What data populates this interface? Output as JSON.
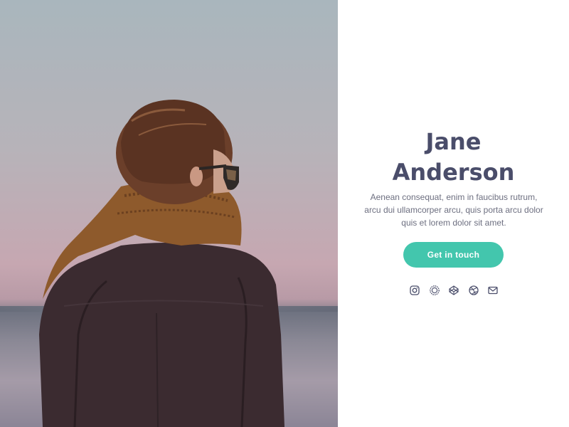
{
  "profile": {
    "name_line1": "Jane",
    "name_line2": "Anderson",
    "bio": "Aenean consequat, enim in faucibus rutrum, arcu dui ullamcorper arcu, quis porta arcu dolor quis et lorem dolor sit amet.",
    "cta_label": "Get in touch"
  },
  "socials": [
    {
      "icon": "instagram-icon"
    },
    {
      "icon": "sun-burst-icon"
    },
    {
      "icon": "codepen-icon"
    },
    {
      "icon": "dribbble-icon"
    },
    {
      "icon": "mail-icon"
    }
  ],
  "colors": {
    "accent": "#43c6ad",
    "heading": "#4a4d6a",
    "body_text": "#6d6f80",
    "icon": "#4a4d6a"
  }
}
